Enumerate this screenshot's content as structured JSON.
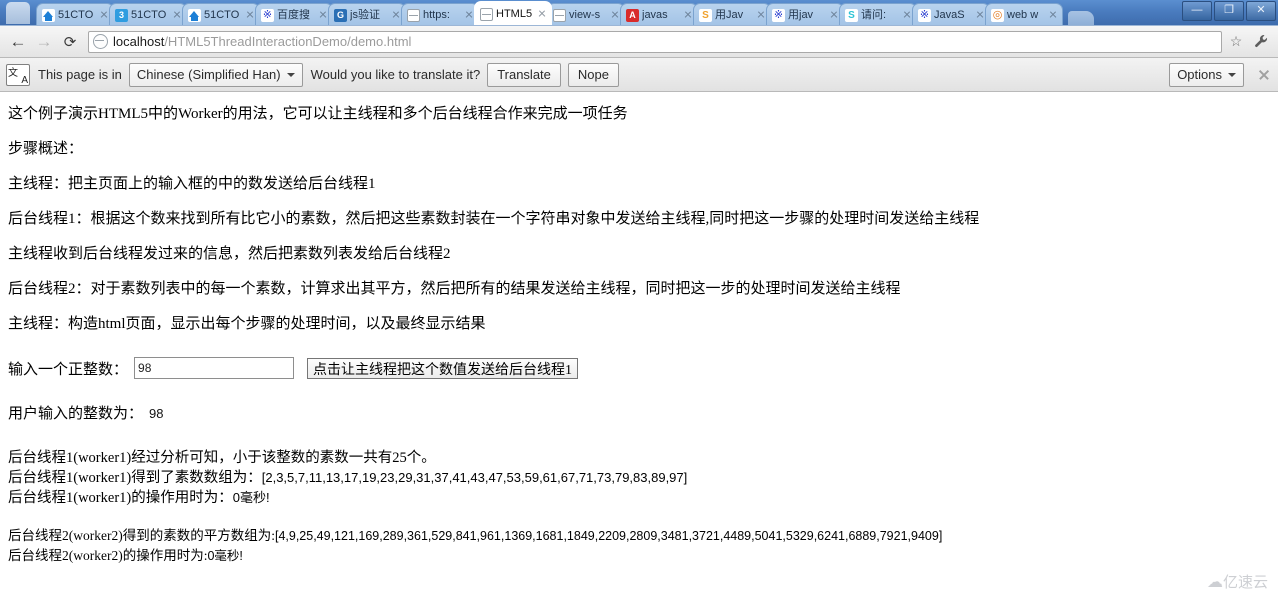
{
  "browser": {
    "tabs": [
      {
        "title": "51CTO",
        "favicon": "house-icon",
        "active": false
      },
      {
        "title": "51CTO",
        "favicon": "blue-3-icon",
        "active": false
      },
      {
        "title": "51CTO",
        "favicon": "house-icon",
        "active": false
      },
      {
        "title": "百度搜",
        "favicon": "baidu-paw-icon",
        "active": false
      },
      {
        "title": "js验证",
        "favicon": "g-icon",
        "active": false
      },
      {
        "title": "https:",
        "favicon": "globe-icon",
        "active": false
      },
      {
        "title": "HTML5",
        "favicon": "globe-icon",
        "active": true
      },
      {
        "title": "view-s",
        "favicon": "globe-icon",
        "active": false
      },
      {
        "title": "javas",
        "favicon": "red-a-icon",
        "active": false
      },
      {
        "title": "用Jav",
        "favicon": "orange-s-icon",
        "active": false
      },
      {
        "title": "用jav",
        "favicon": "baidu-paw-icon",
        "active": false
      },
      {
        "title": "请问:",
        "favicon": "cyan-s-icon",
        "active": false
      },
      {
        "title": "JavaS",
        "favicon": "baidu-paw-icon",
        "active": false
      },
      {
        "title": "web w",
        "favicon": "hex-icon",
        "active": false
      }
    ],
    "window_buttons": {
      "minimize": "—",
      "maximize": "❐",
      "close": "✕"
    },
    "nav": {
      "back": "←",
      "forward": "→",
      "reload": "⟳"
    },
    "url_host": "localhost",
    "url_path": "/HTML5ThreadInteractionDemo/demo.html",
    "bookmark_icon": "☆",
    "menu_icon": "🔧"
  },
  "infobar": {
    "icon_name": "translate-icon",
    "prefix_text": "This page is in",
    "language": "Chinese (Simplified Han)",
    "question_text": "Would you like to translate it?",
    "translate_label": "Translate",
    "nope_label": "Nope",
    "options_label": "Options",
    "close_icon": "✕"
  },
  "page": {
    "intro": "这个例子演示HTML5中的Worker的用法，它可以让主线程和多个后台线程合作来完成一项任务",
    "steps_heading": "步骤概述：",
    "step1": "主线程：把主页面上的输入框的中的数发送给后台线程1",
    "step2": "后台线程1：根据这个数来找到所有比它小的素数，然后把这些素数封装在一个字符串对象中发送给主线程,同时把这一步骤的处理时间发送给主线程",
    "step3": "主线程收到后台线程发过来的信息，然后把素数列表发给后台线程2",
    "step4": "后台线程2：对于素数列表中的每一个素数，计算求出其平方，然后把所有的结果发送给主线程，同时把这一步的处理时间发送给主线程",
    "step5": "主线程：构造html页面，显示出每个步骤的处理时间，以及最终显示结果",
    "form": {
      "label": "输入一个正整数：",
      "input_value": "98",
      "input_placeholder": "",
      "button_label": "点击让主线程把这个数值发送给后台线程1"
    },
    "echo_label": "用户输入的整数为：",
    "echo_value": "98",
    "worker1": {
      "count_line": "后台线程1(worker1)经过分析可知，小于该整数的素数一共有25个。",
      "array_label": "后台线程1(worker1)得到了素数数组为：",
      "array_value": "[2,3,5,7,11,13,17,19,23,29,31,37,41,43,47,53,59,61,67,71,73,79,83,89,97]",
      "time_line": "后台线程1(worker1)的操作用时为：",
      "time_value": "0毫秒!"
    },
    "worker2": {
      "array_label": "后台线程2(worker2)得到的素数的平方数组为:",
      "array_value": "[4,9,25,49,121,169,289,361,529,841,961,1369,1681,1849,2209,2809,3481,3721,4489,5041,5329,6241,6889,7921,9409]",
      "time_line": "后台线程2(worker2)的操作用时为:",
      "time_value": "0毫秒!"
    }
  },
  "watermark": {
    "icon": "☁",
    "text": "亿速云"
  }
}
